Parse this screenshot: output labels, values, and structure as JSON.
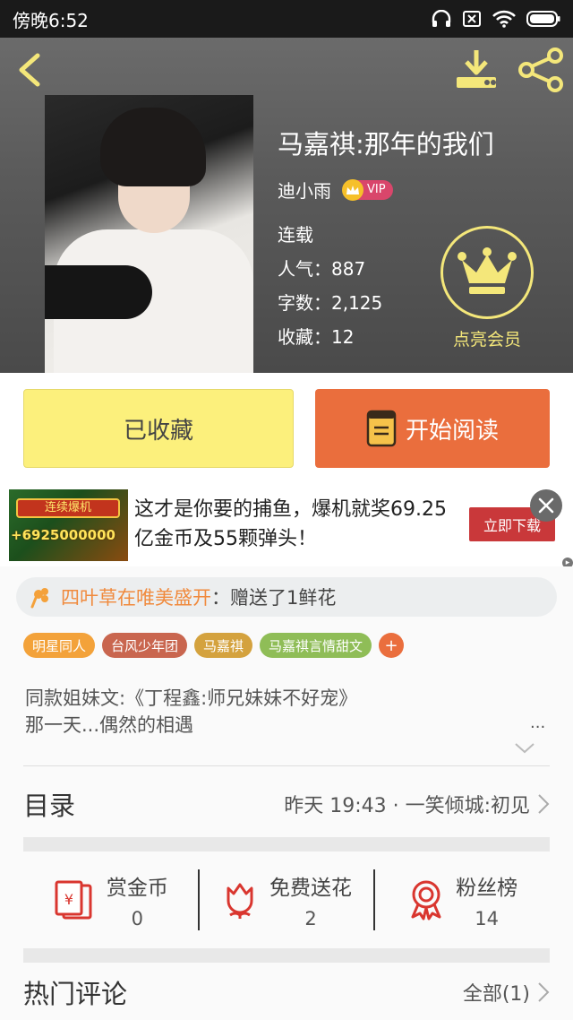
{
  "status_bar": {
    "time": "傍晚6:52"
  },
  "book": {
    "title": "马嘉祺:那年的我们",
    "author": "迪小雨",
    "vip_badge": "VIP",
    "status": "连载",
    "popularity": "人气：887",
    "word_count": "字数：2,125",
    "favorites": "收藏：12",
    "member_label": "点亮会员"
  },
  "actions": {
    "collected_label": "已收藏",
    "read_label": "开始阅读"
  },
  "ad": {
    "image_banner": "连续爆机",
    "image_amount": "+6925000000",
    "text": "这才是你要的捕鱼，爆机就奖69.25亿金币及55颗弹头！",
    "button_label": "立即下载"
  },
  "gift": {
    "donor": "四叶草在唯美盛开",
    "message": "：赠送了1鲜花"
  },
  "tags": [
    {
      "label": "明星同人",
      "color": "#f3a23a"
    },
    {
      "label": "台风少年团",
      "color": "#c9664f"
    },
    {
      "label": "马嘉祺",
      "color": "#d4a23e"
    },
    {
      "label": "马嘉祺言情甜文",
      "color": "#8fbd57"
    }
  ],
  "tag_add_label": "+",
  "description": {
    "line1": "同款姐妹文:《丁程鑫:师兄妹妹不好宠》",
    "line2": "那一天...偶然的相遇",
    "more": "..."
  },
  "catalog": {
    "label": "目录",
    "latest": "昨天 19:43 · 一笑倾城:初见"
  },
  "stats": [
    {
      "name": "赏金币",
      "value": "0",
      "icon": "red-envelope-icon"
    },
    {
      "name": "免费送花",
      "value": "2",
      "icon": "flower-icon"
    },
    {
      "name": "粉丝榜",
      "value": "14",
      "icon": "medal-icon"
    }
  ],
  "hot_comments": {
    "label": "热门评论",
    "all": "全部(1)"
  },
  "colors": {
    "accent_orange": "#ea6e3d",
    "collect_yellow": "#fcf07c",
    "member_gold": "#f4e77a",
    "icon_red": "#d9362f"
  }
}
